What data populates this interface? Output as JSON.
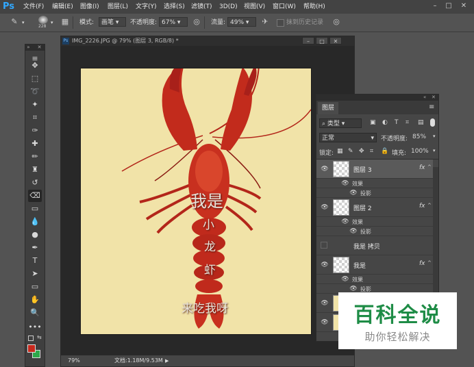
{
  "app": {
    "logo": "Ps"
  },
  "menu": [
    "文件(F)",
    "编辑(E)",
    "图像(I)",
    "图层(L)",
    "文字(Y)",
    "选择(S)",
    "滤镜(T)",
    "3D(D)",
    "视图(V)",
    "窗口(W)",
    "帮助(H)"
  ],
  "options": {
    "brush_size": "228",
    "mode_label": "模式:",
    "mode_value": "画笔",
    "opacity_label": "不透明度:",
    "opacity_value": "67%",
    "flow_label": "流量:",
    "flow_value": "49%",
    "history_label": "抹到历史记录"
  },
  "document": {
    "tab_title": "IMG_2226.JPG @ 79% (图层 3, RGB/8) *",
    "zoom": "79%",
    "doc_info": "文档:1.18M/9.53M",
    "canvas_texts": [
      "我是",
      "小",
      "龙",
      "虾",
      "来吃我呀"
    ]
  },
  "layers_panel": {
    "tab": "图层",
    "filter": "类型",
    "blend_mode": "正常",
    "opacity_label": "不透明度:",
    "opacity_value": "85%",
    "lock_label": "锁定:",
    "fill_label": "填充:",
    "fill_value": "100%",
    "layers": [
      {
        "name": "图层 3",
        "fx": "fx",
        "effects_label": "效果",
        "effect": "投影"
      },
      {
        "name": "图层 2",
        "fx": "fx",
        "effects_label": "效果",
        "effect": "投影"
      },
      {
        "name": "我是 拷贝"
      },
      {
        "name": "我是",
        "fx": "fx",
        "effects_label": "效果",
        "effect": "投影"
      }
    ]
  },
  "watermark": {
    "title": "百科全说",
    "subtitle": "助你轻松解决"
  },
  "colors": {
    "accent": "#31a8ff",
    "foreground": "#c8281c",
    "background": "#2da84a",
    "canvas_bg": "#f1e3a8",
    "watermark_green": "#1e8c46"
  }
}
